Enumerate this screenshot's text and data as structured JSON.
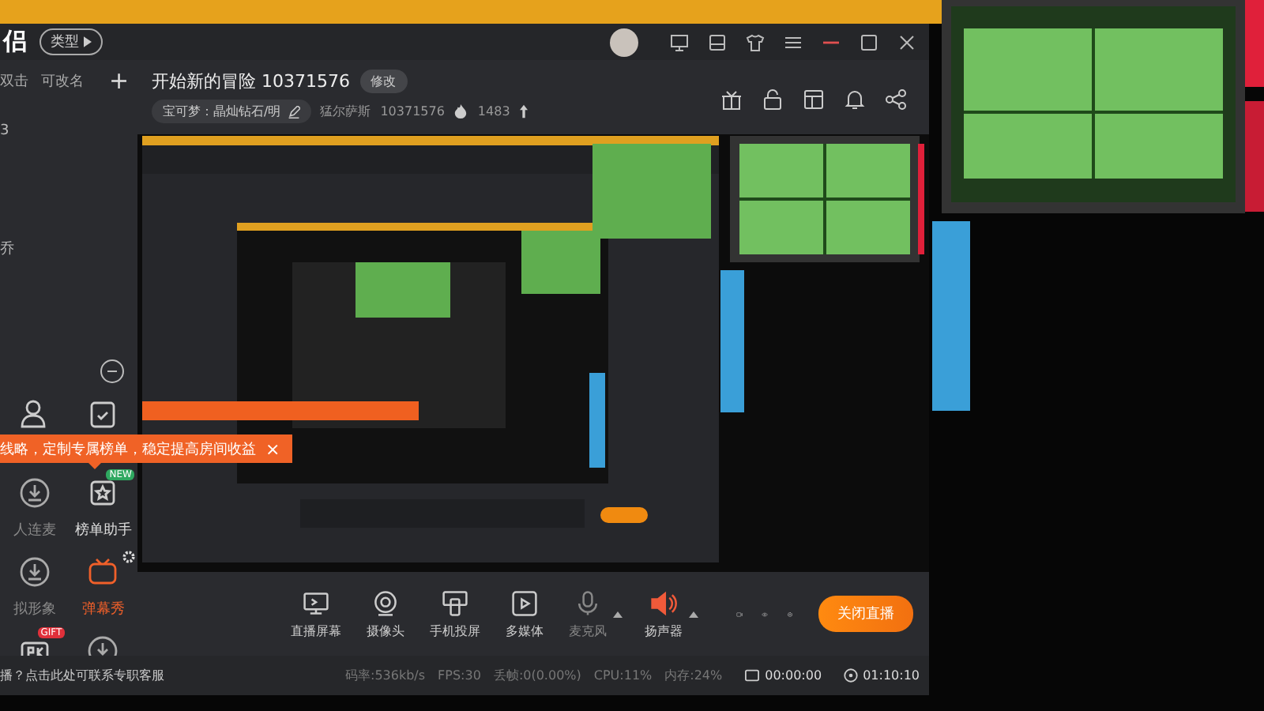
{
  "title_bar": {
    "logo": "侣",
    "category": "类型"
  },
  "sidebar": {
    "tabs": [
      {
        "label": "双击",
        "selected": false
      },
      {
        "label": "可改名",
        "selected": false
      }
    ],
    "add": "+",
    "list": [
      "3",
      "乔"
    ],
    "tools": [
      {
        "kind": "person",
        "installed": true,
        "active": false
      },
      {
        "kind": "clipboard",
        "installed": true,
        "active": false
      },
      {
        "kind": "download",
        "label": "人连麦",
        "installed": false,
        "active": false
      },
      {
        "kind": "ranking",
        "label": "榜单助手",
        "badge": "NEW",
        "installed": true,
        "active": false
      },
      {
        "kind": "download",
        "label": "拟形象",
        "installed": false,
        "active": false
      },
      {
        "kind": "danmaku",
        "label": "弹幕秀",
        "installed": true,
        "active": true
      },
      {
        "kind": "pk",
        "badge": "GIFT",
        "installed": true,
        "active": false
      },
      {
        "kind": "download",
        "installed": false,
        "active": false
      }
    ]
  },
  "toast": {
    "text": "线略，定制专属榜单，稳定提高房间收益",
    "close": "×"
  },
  "room": {
    "title": "开始新的冒险 10371576",
    "edit": "修改",
    "category": "宝可梦：晶灿钻石/明",
    "streamer": "猛尔萨斯",
    "room_id": "10371576",
    "heat": "1483"
  },
  "toolbar": [
    {
      "kind": "screen",
      "label": "直播屏幕",
      "enabled": true,
      "menu": false
    },
    {
      "kind": "camera",
      "label": "摄像头",
      "enabled": true,
      "menu": false
    },
    {
      "kind": "phone",
      "label": "手机投屏",
      "enabled": true,
      "menu": false
    },
    {
      "kind": "media",
      "label": "多媒体",
      "enabled": true,
      "menu": false
    },
    {
      "kind": "mic",
      "label": "麦克风",
      "enabled": false,
      "menu": true
    },
    {
      "kind": "speaker",
      "label": "扬声器",
      "enabled": true,
      "menu": true
    }
  ],
  "stop_button": "关闭直播",
  "status_bar": {
    "help": "播？点击此处可联系专职客服",
    "stats": [
      "码率:536kb/s",
      "FPS:30",
      "丢帧:0(0.00%)",
      "CPU:11%",
      "内存:24%"
    ],
    "timers": [
      {
        "kind": "record",
        "value": "00:00:00"
      },
      {
        "kind": "clock",
        "value": "01:10:10"
      }
    ]
  }
}
